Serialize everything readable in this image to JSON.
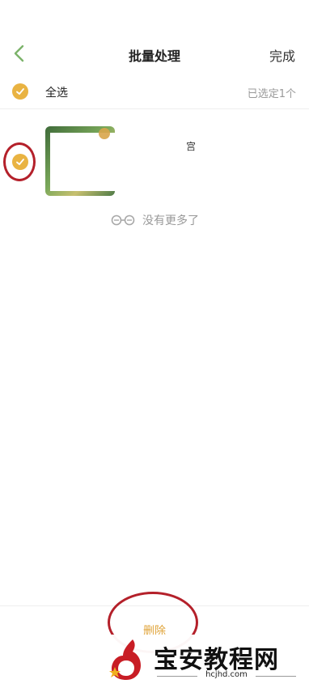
{
  "header": {
    "title": "批量处理",
    "done_label": "完成"
  },
  "select_all": {
    "label": "全选",
    "selected_count": "已选定1个"
  },
  "items": [
    {
      "title": "宫",
      "selected": true
    }
  ],
  "list_footer": "没有更多了",
  "bottom": {
    "delete_label": "删除"
  },
  "watermark": {
    "brand": "宝安教程网",
    "domain": "hcjhd.com"
  },
  "colors": {
    "accent": "#e9b342",
    "delete_text": "#e0a43a",
    "annotation_red": "#b4202a",
    "back_arrow": "#7cb36a"
  }
}
